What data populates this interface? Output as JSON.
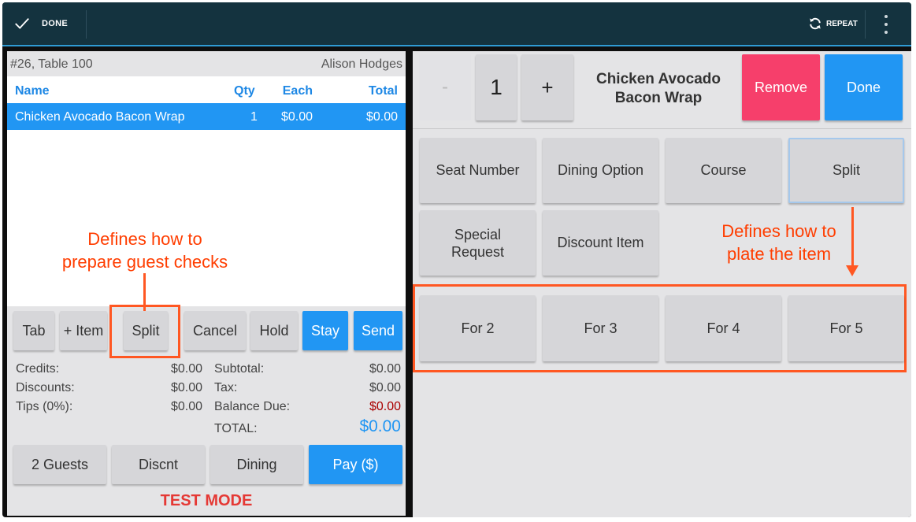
{
  "topbar": {
    "done_label": "DONE",
    "repeat_label": "REPEAT",
    "icons": [
      "check-icon",
      "repeat-icon",
      "more-vert-icon"
    ]
  },
  "order": {
    "header_left": "#26, Table 100",
    "header_right": "Alison Hodges",
    "columns": [
      "Name",
      "Qty",
      "Each",
      "Total"
    ],
    "items": [
      {
        "name": "Chicken Avocado Bacon Wrap",
        "qty": "1",
        "each": "$0.00",
        "total": "$0.00"
      }
    ]
  },
  "annotations": {
    "left_line1": "Defines how to",
    "left_line2": "prepare guest checks",
    "right_line1": "Defines how to",
    "right_line2": "plate the item"
  },
  "actions": {
    "tab": "Tab",
    "add_item": "+ Item",
    "split": "Split",
    "cancel": "Cancel",
    "hold": "Hold",
    "stay": "Stay",
    "send": "Send"
  },
  "totals": {
    "credits_label": "Credits:",
    "credits_value": "$0.00",
    "discounts_label": "Discounts:",
    "discounts_value": "$0.00",
    "tips_label": "Tips (0%):",
    "tips_value": "$0.00",
    "subtotal_label": "Subtotal:",
    "subtotal_value": "$0.00",
    "tax_label": "Tax:",
    "tax_value": "$0.00",
    "balance_label": "Balance Due:",
    "balance_value": "$0.00",
    "total_label": "TOTAL:",
    "total_value": "$0.00"
  },
  "bottom": {
    "guests": "2 Guests",
    "discount": "Discnt",
    "dining": "Dining",
    "pay": "Pay ($)",
    "test_mode": "TEST MODE"
  },
  "item_panel": {
    "minus": "-",
    "quantity": "1",
    "plus": "+",
    "title_line1": "Chicken Avocado",
    "title_line2": "Bacon Wrap",
    "remove": "Remove",
    "done": "Done",
    "options": [
      "Seat Number",
      "Dining Option",
      "Course",
      "Split",
      "Special Request",
      "Discount Item"
    ],
    "selected_option": "Split",
    "split_options": [
      "For 2",
      "For 3",
      "For 4",
      "For 5"
    ]
  },
  "colors": {
    "topbar": "#14333f",
    "accent_blue": "#2196f3",
    "remove_pink": "#f63f6b",
    "annotation_orange": "#ff5722",
    "test_mode_red": "#e53935"
  }
}
